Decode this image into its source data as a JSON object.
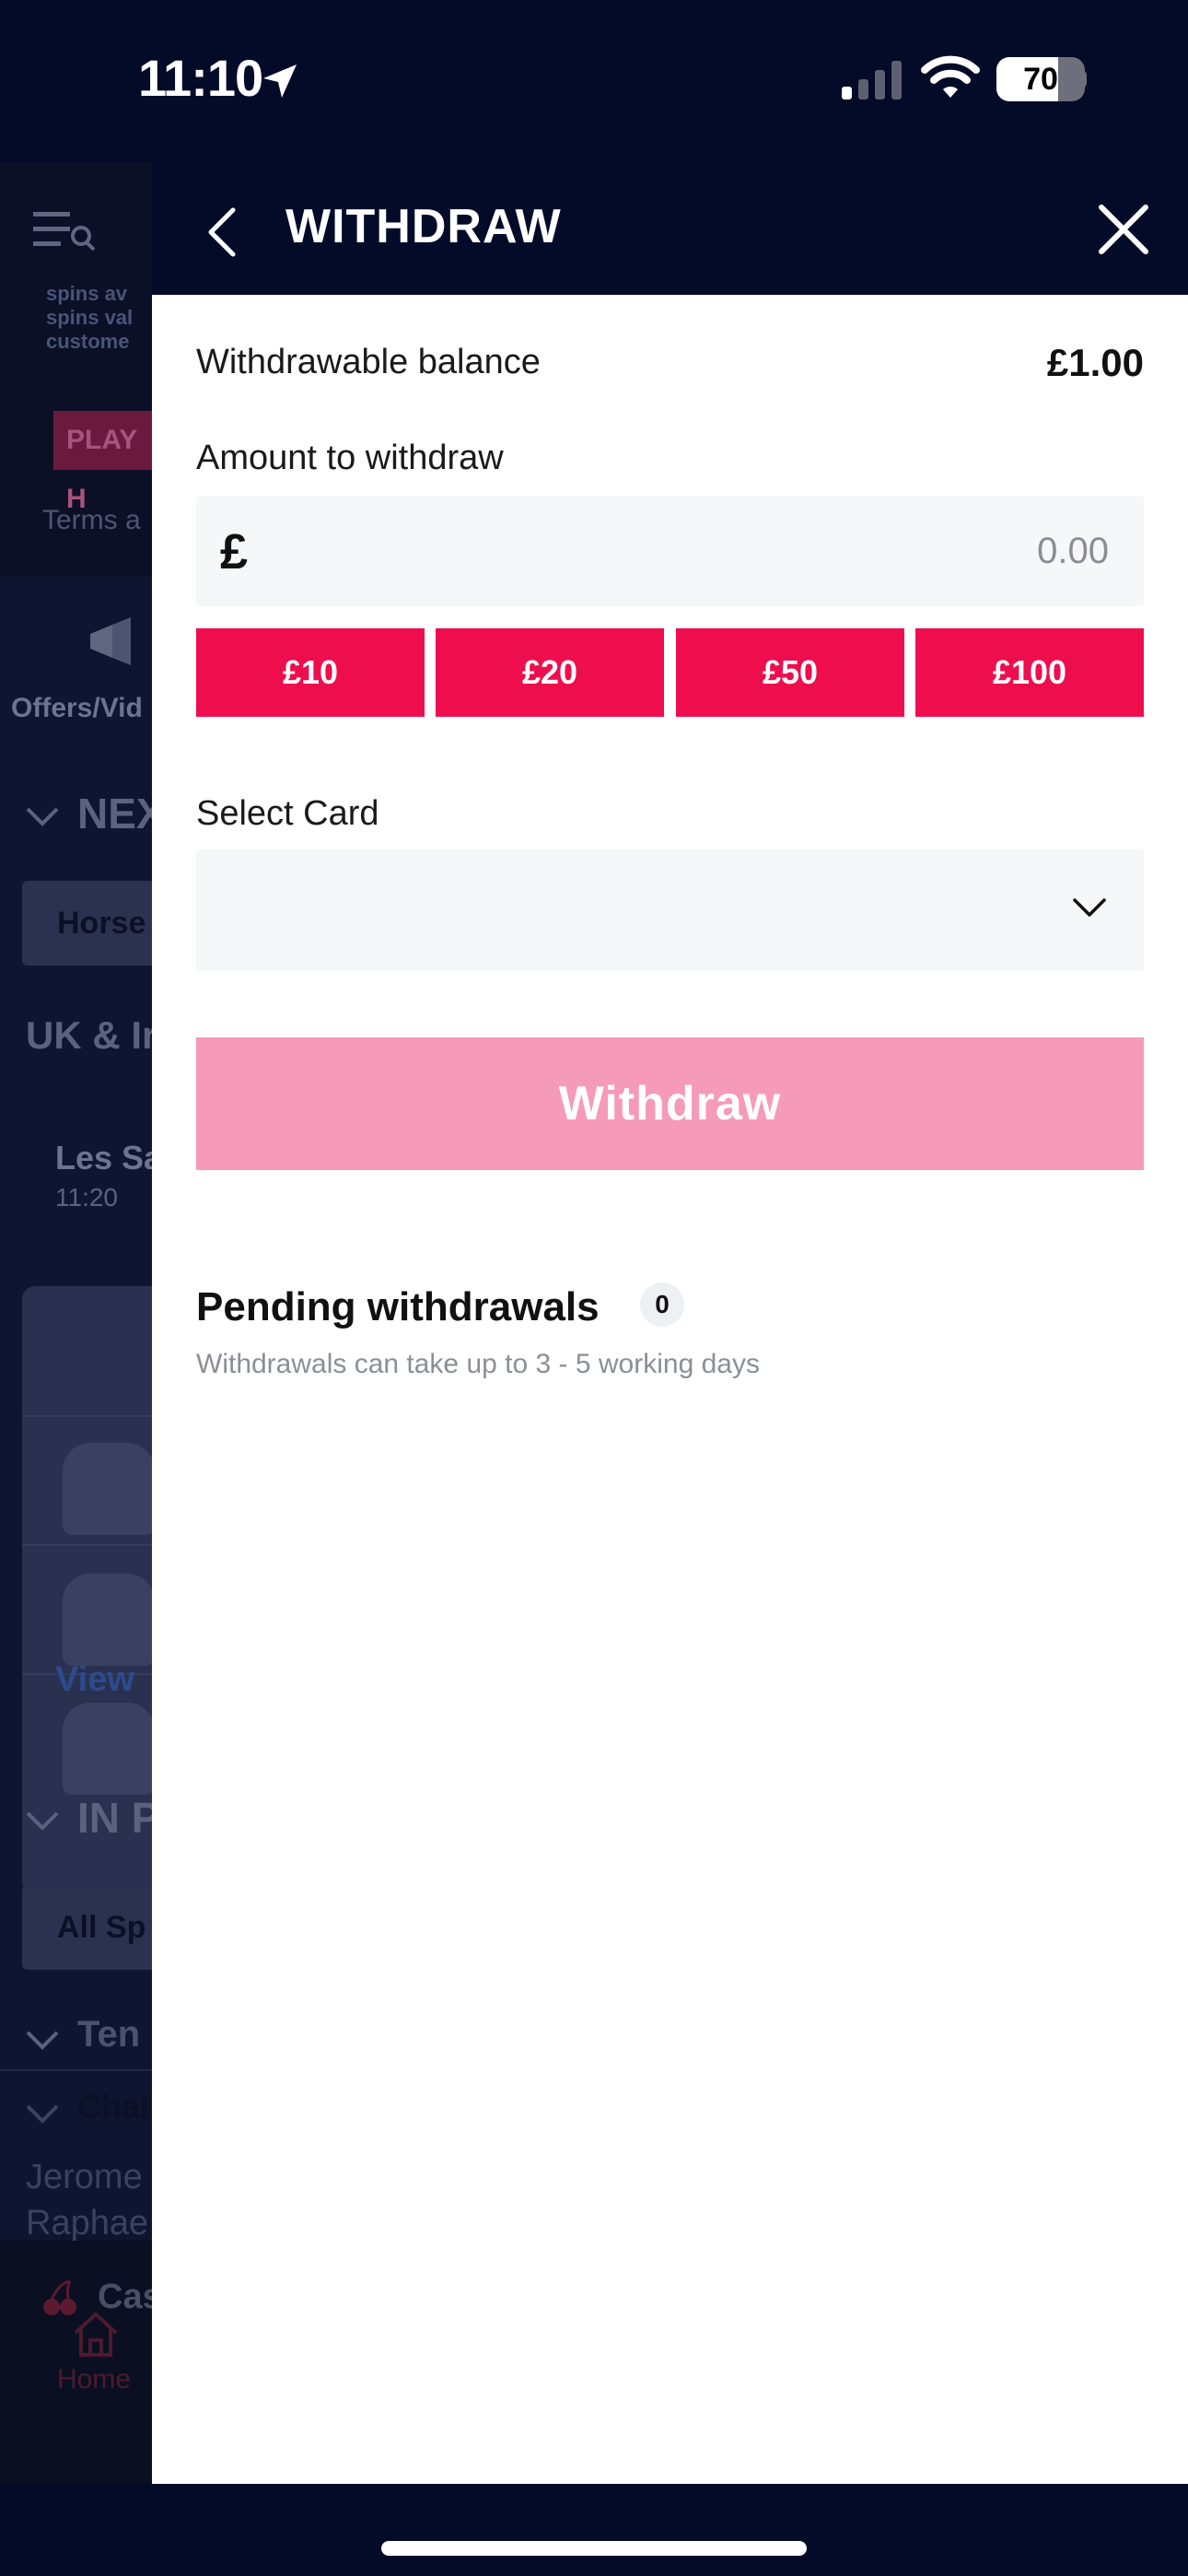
{
  "status_bar": {
    "time": "11:10",
    "battery_level": "70",
    "battery_fraction": 0.7,
    "icons": [
      "location-arrow-icon",
      "signal-icon",
      "wifi-icon",
      "battery-icon"
    ]
  },
  "background_page": {
    "promo_lines": [
      "spins av",
      "spins val",
      "custome"
    ],
    "play_button": "PLAY H",
    "terms": "Terms a",
    "offers": "Offers/Vid",
    "next_heading": "NEX",
    "horse_pill": "Horse",
    "uk_heading": "UK & Ir",
    "race_name": "Les Sa",
    "race_time": "11:20",
    "view_link": "View",
    "in_play_heading": "IN P",
    "all_sports_pill": "All Sp",
    "tennis_heading": "Ten",
    "chal_heading": "Chal",
    "player_1": "Jerome",
    "player_2": "Raphae",
    "casino": "Cas",
    "home": "Home"
  },
  "modal": {
    "title": "WITHDRAW",
    "balance_label": "Withdrawable balance",
    "balance_value": "£1.00",
    "amount_label": "Amount to withdraw",
    "currency_symbol": "£",
    "amount_placeholder": "0.00",
    "quick_amounts": [
      "£10",
      "£20",
      "£50",
      "£100"
    ],
    "card_label": "Select Card",
    "card_value": "",
    "withdraw_label": "Withdraw",
    "pending_title": "Pending withdrawals",
    "pending_count": "0",
    "pending_note": "Withdrawals can take up to 3 - 5 working days"
  },
  "colors": {
    "navy": "#030b29",
    "brand_pink": "#ee0e4d",
    "disabled_pink": "#f69aba",
    "input_bg": "#f6f7f9"
  }
}
